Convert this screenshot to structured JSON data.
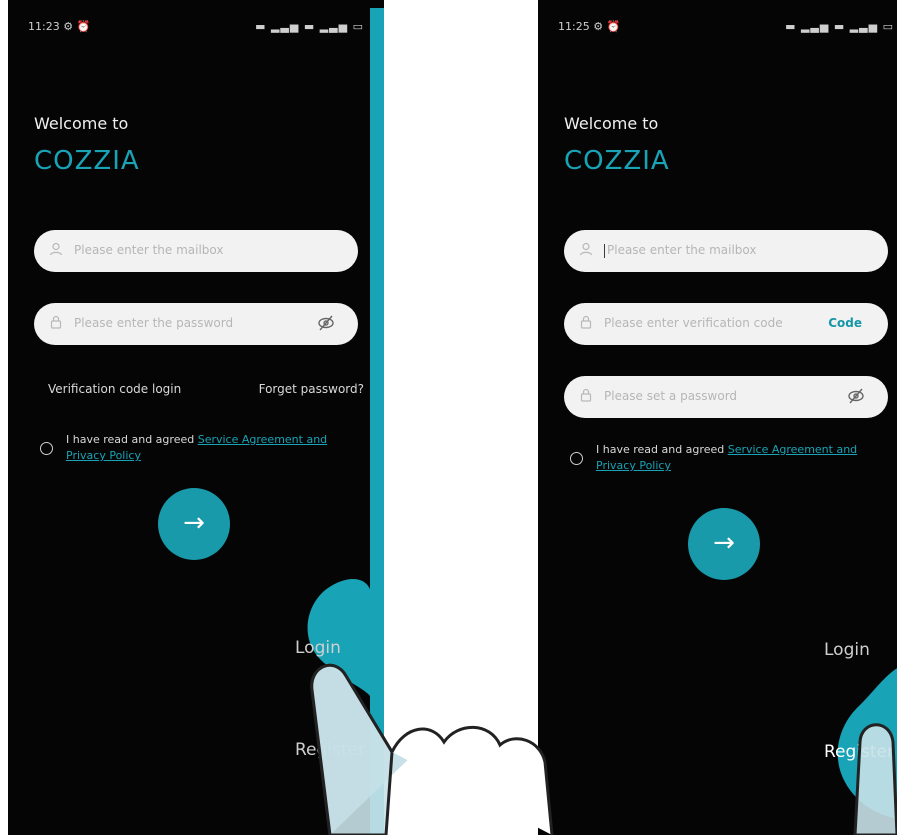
{
  "screens": [
    {
      "status_time": "11:23",
      "status_alarm": "⚙ ⏰",
      "status_icons": "▬ ▂▃▅ ▬ ▂▃▅ ▭",
      "welcome": "Welcome to",
      "brand": "COZZIA",
      "email_placeholder": "Please enter the mailbox",
      "password_placeholder": "Please enter the password",
      "verification_login": "Verification code login",
      "forget_password": "Forget password?",
      "agree_text": "I have read and agreed ",
      "agree_link": "Service Agreement and Privacy Policy",
      "submit_glyph": "→",
      "login_label": "Login",
      "register_label": "Register"
    },
    {
      "status_time": "11:25",
      "status_alarm": "⚙ ⏰",
      "status_icons": "▬ ▂▃▅ ▬ ▂▃▅ ▭",
      "welcome": "Welcome to",
      "brand": "COZZIA",
      "email_placeholder": "Please enter the mailbox",
      "code_placeholder": "Please enter verification code",
      "code_button": "Code",
      "password_placeholder": "Please set a password",
      "agree_text": "I have read and agreed ",
      "agree_link": "Service Agreement and Privacy Policy",
      "submit_glyph": "→",
      "login_label": "Login",
      "register_label": "Register"
    }
  ],
  "icons": {
    "user": "user-icon",
    "lock": "lock-icon",
    "eye_hidden": "eye-off-icon",
    "arrow": "arrow-right-icon",
    "hand": "pointing-hand-icon"
  },
  "colors": {
    "accent": "#18a3b6",
    "background": "#050505",
    "field": "#f2f2f2"
  }
}
